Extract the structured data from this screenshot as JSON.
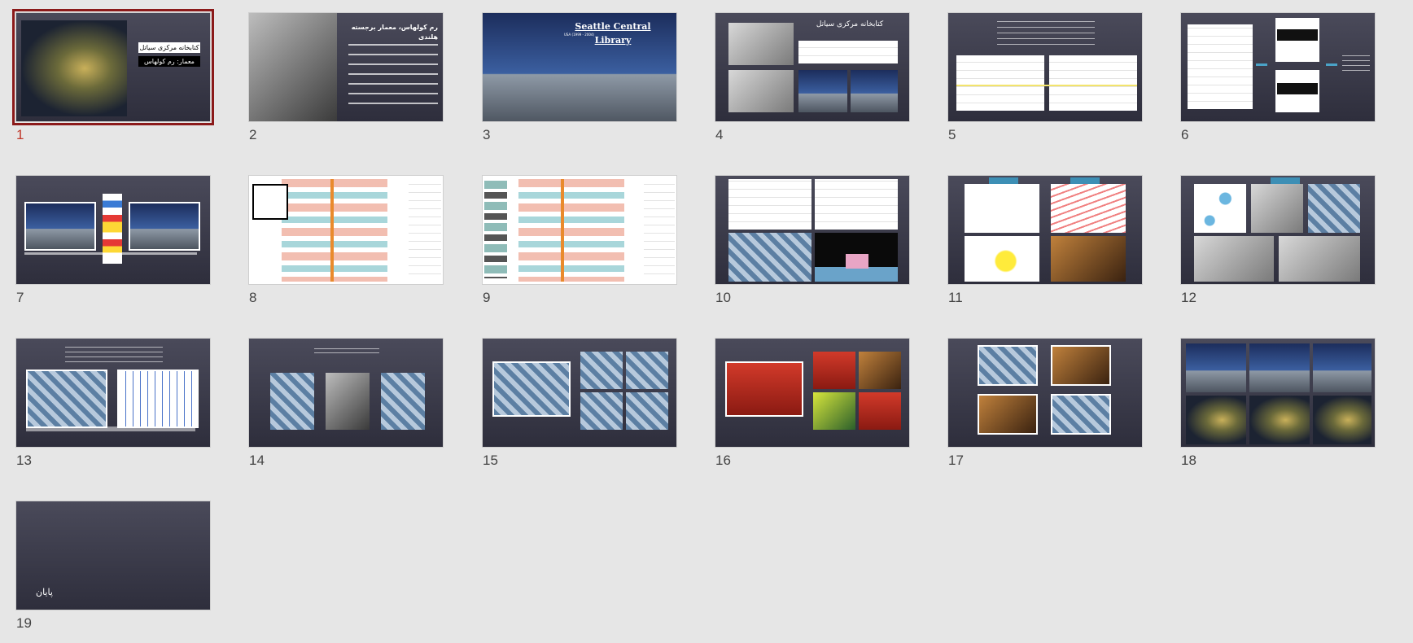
{
  "view": "slide-sorter",
  "selected_slide": 1,
  "colors": {
    "background": "#e6e6e6",
    "selection": "#8b1a1a",
    "selected_number": "#c0392b",
    "slide_bg": "#3a3a48"
  },
  "slides": [
    {
      "number": "1",
      "title": "کتابخانه مرکزی سیاتل",
      "subtitle": "معمار: رم کولهاس"
    },
    {
      "number": "2",
      "title": "رم کولهاس، معمار برجسته هلندی"
    },
    {
      "number": "3",
      "title": "Seattle Central Library",
      "subtitle": "USA (1999 - 2004)"
    },
    {
      "number": "4",
      "title": "کتابخانه مرکزی سیاتل"
    },
    {
      "number": "5"
    },
    {
      "number": "6"
    },
    {
      "number": "7"
    },
    {
      "number": "8"
    },
    {
      "number": "9"
    },
    {
      "number": "10"
    },
    {
      "number": "11"
    },
    {
      "number": "12"
    },
    {
      "number": "13"
    },
    {
      "number": "14"
    },
    {
      "number": "15"
    },
    {
      "number": "16"
    },
    {
      "number": "17"
    },
    {
      "number": "18"
    },
    {
      "number": "19",
      "title": "پایان"
    }
  ]
}
